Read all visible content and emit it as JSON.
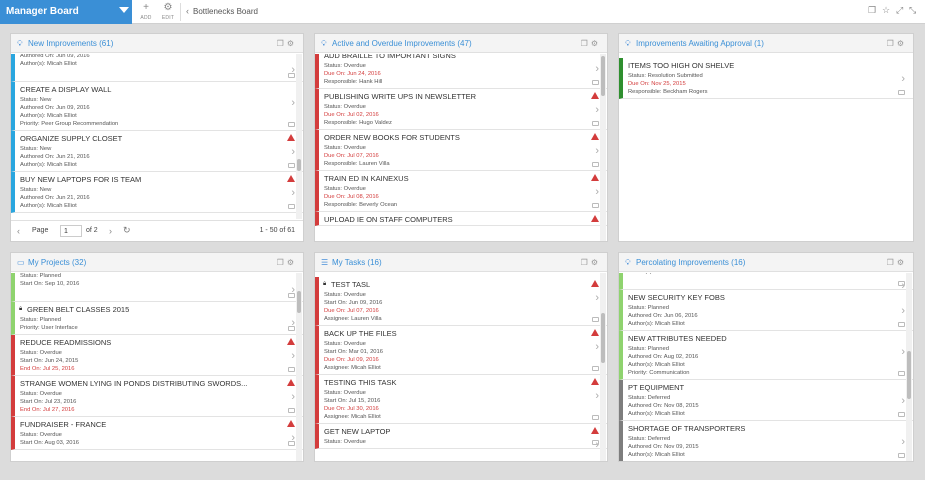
{
  "topbar": {
    "board_title": "Manager Board",
    "add_label": "ADD",
    "edit_label": "EDIT",
    "breadcrumb": "Bottlenecks Board"
  },
  "panels": [
    {
      "title": "New Improvements (61)",
      "icon": "lightbulb-icon",
      "cards": [
        {
          "title": "",
          "lines": [
            "Authored On: Jun 09, 2016",
            "Author(s): Micah Elliot"
          ],
          "color": "blue"
        },
        {
          "title": "CREATE A DISPLAY WALL",
          "lines": [
            "Status: New",
            "Authored On: Jun 09, 2016",
            "Author(s): Micah Elliot",
            "Priority: Peer Group Recommendation"
          ],
          "color": "blue"
        },
        {
          "title": "ORGANIZE SUPPLY CLOSET",
          "lines": [
            "Status: New",
            "Authored On: Jun 21, 2016",
            "Author(s): Micah Elliot"
          ],
          "color": "blue",
          "warn": true
        },
        {
          "title": "BUY NEW LAPTOPS FOR IS TEAM",
          "lines": [
            "Status: New",
            "Authored On: Jun 21, 2016",
            "Author(s): Micah Elliot"
          ],
          "color": "blue",
          "warn": true
        }
      ],
      "pager": {
        "page_label": "Page",
        "page_value": "1",
        "of_label": "of 2",
        "range": "1 - 50 of 61"
      }
    },
    {
      "title": "Active and Overdue Improvements (47)",
      "icon": "lightbulb-icon",
      "cards": [
        {
          "title": "ADD BRAILLE TO IMPORTANT SIGNS",
          "lines": [
            "Status: Overdue",
            "Due On: Jun 24, 2016",
            "Responsible: Hank Hill"
          ],
          "red_index": 1,
          "color": "red"
        },
        {
          "title": "PUBLISHING WRITE UPS IN NEWSLETTER",
          "lines": [
            "Status: Overdue",
            "Due On: Jul 02, 2016",
            "Responsible: Hugo Valdez"
          ],
          "red_index": 1,
          "color": "red",
          "warn": true
        },
        {
          "title": "ORDER NEW BOOKS FOR STUDENTS",
          "lines": [
            "Status: Overdue",
            "Due On: Jul 07, 2016",
            "Responsible: Lauren Villa"
          ],
          "red_index": 1,
          "color": "red",
          "warn": true
        },
        {
          "title": "TRAIN ED IN KAINEXUS",
          "lines": [
            "Status: Overdue",
            "Due On: Jul 08, 2016",
            "Responsible: Beverly Ocean"
          ],
          "red_index": 1,
          "color": "red",
          "warn": true
        },
        {
          "title": "UPLOAD IE ON STAFF COMPUTERS",
          "lines": [],
          "color": "red",
          "warn": true
        }
      ]
    },
    {
      "title": "Improvements Awaiting Approval (1)",
      "icon": "lightbulb-icon",
      "cards": [
        {
          "title": "ITEMS TOO HIGH ON SHELVE",
          "lines": [
            "Status: Resolution Submitted",
            "Due On: Nov 25, 2015",
            "Responsible: Beckham Rogers"
          ],
          "red_index": 1,
          "color": "green"
        }
      ]
    },
    {
      "title": "My Projects (32)",
      "icon": "folder-icon",
      "cards": [
        {
          "title": "",
          "lines": [
            "Status: Planned",
            "Start On: Sep 10, 2016"
          ],
          "color": "lgreen"
        },
        {
          "title": "GREEN BELT CLASSES 2015",
          "lines": [
            "Status: Planned",
            "Priority: User Interface"
          ],
          "color": "lgreen",
          "lock": true
        },
        {
          "title": "REDUCE READMISSIONS",
          "lines": [
            "Status: Overdue",
            "Start On: Jun 24, 2015",
            "End On: Jul 25, 2016"
          ],
          "red_index": 2,
          "color": "red",
          "warn": true
        },
        {
          "title": "STRANGE WOMEN LYING IN PONDS DISTRIBUTING SWORDS...",
          "lines": [
            "Status: Overdue",
            "Start On: Jul 23, 2016",
            "End On: Jul 27, 2016"
          ],
          "red_index": 2,
          "color": "red",
          "warn": true
        },
        {
          "title": "FUNDRAISER - FRANCE",
          "lines": [
            "Status: Overdue",
            "Start On: Aug 03, 2016"
          ],
          "color": "red",
          "warn": true
        }
      ]
    },
    {
      "title": "My Tasks (16)",
      "icon": "list-icon",
      "cards": [
        {
          "title": "TEST TASL",
          "lines": [
            "Status: Overdue",
            "Start On: Jun 09, 2016",
            "Due On: Jul 07, 2016",
            "Assignee: Lauren Villa"
          ],
          "red_index": 2,
          "color": "red",
          "warn": true,
          "lock": true
        },
        {
          "title": "BACK UP THE FILES",
          "lines": [
            "Status: Overdue",
            "Start On: Mar 01, 2016",
            "Due On: Jul 09, 2016",
            "Assignee: Micah Elliot"
          ],
          "red_index": 2,
          "color": "red",
          "warn": true
        },
        {
          "title": "TESTING THIS TASK",
          "lines": [
            "Status: Overdue",
            "Start On: Jul 15, 2016",
            "Due On: Jul 30, 2016",
            "Assignee: Micah Elliot"
          ],
          "red_index": 2,
          "color": "red",
          "warn": true
        },
        {
          "title": "GET NEW LAPTOP",
          "lines": [
            "Status: Overdue"
          ],
          "color": "red",
          "warn": true
        }
      ]
    },
    {
      "title": "Percolating Improvements (16)",
      "icon": "lightbulb-icon",
      "cards": [
        {
          "title": "",
          "lines": [
            "Author(s): Micah Elliot"
          ],
          "color": "lgreen"
        },
        {
          "title": "NEW SECURITY KEY FOBS",
          "lines": [
            "Status: Planned",
            "Authored On: Jun 06, 2016",
            "Author(s): Micah Elliot"
          ],
          "color": "lgreen"
        },
        {
          "title": "NEW ATTRIBUTES NEEDED",
          "lines": [
            "Status: Planned",
            "Authored On: Aug 02, 2016",
            "Author(s): Micah Elliot",
            "Priority: Communication"
          ],
          "color": "lgreen"
        },
        {
          "title": "PT EQUIPMENT",
          "lines": [
            "Status: Deferred",
            "Authored On: Nov 08, 2015",
            "Author(s): Micah Elliot"
          ],
          "color": "gray"
        },
        {
          "title": "SHORTAGE OF TRANSPORTERS",
          "lines": [
            "Status: Deferred",
            "Authored On: Nov 09, 2015",
            "Author(s): Micah Elliot"
          ],
          "color": "gray"
        }
      ]
    }
  ]
}
